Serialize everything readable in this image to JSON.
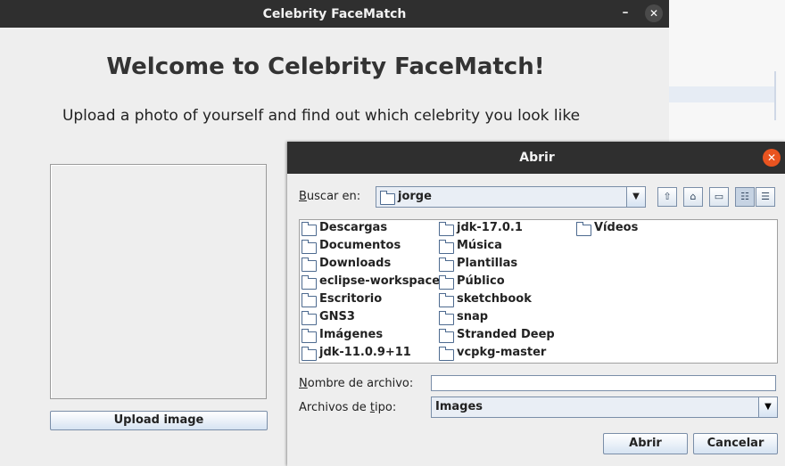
{
  "main": {
    "title": "Celebrity FaceMatch",
    "minimize_symbol": "–",
    "close_symbol": "✕",
    "heading": "Welcome to Celebrity FaceMatch!",
    "subheading": "Upload a photo of yourself and find out which celebrity you look like",
    "upload_label": "Upload image"
  },
  "dialog": {
    "title": "Abrir",
    "close_symbol": "✕",
    "lookin_label_underlined": "B",
    "lookin_label_rest": "uscar en:",
    "lookin_value": "jorge",
    "toolbar_icons": [
      "up-folder-icon",
      "home-icon",
      "new-folder-icon",
      "list-view-icon",
      "details-view-icon"
    ],
    "files": [
      "Descargas",
      "Documentos",
      "Downloads",
      "eclipse-workspace",
      "Escritorio",
      "GNS3",
      "Imágenes",
      "jdk-11.0.9+11",
      "jdk-17.0.1",
      "Música",
      "Plantillas",
      "Público",
      "sketchbook",
      "snap",
      "Stranded Deep",
      "vcpkg-master",
      "Vídeos"
    ],
    "filename_label_underlined": "N",
    "filename_label_rest": "ombre de archivo:",
    "filename_value": "",
    "filetype_label_pre": "Archivos de ",
    "filetype_label_underlined": "t",
    "filetype_label_rest": "ipo:",
    "filetype_value": "Images",
    "open_label": "Abrir",
    "cancel_label": "Cancelar"
  }
}
